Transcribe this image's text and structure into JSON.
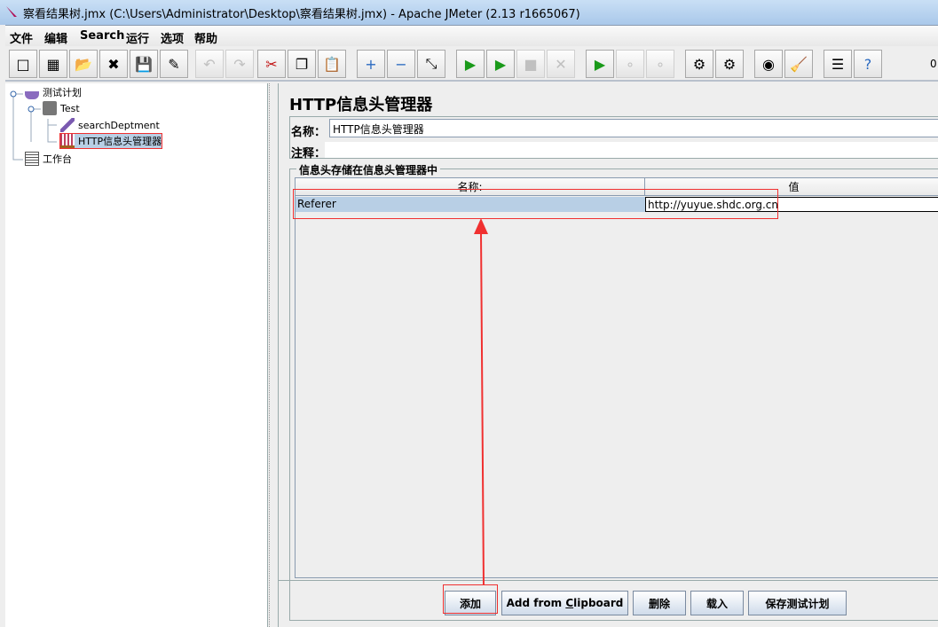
{
  "window": {
    "title": "察看结果树.jmx (C:\\Users\\Administrator\\Desktop\\察看结果树.jmx) - Apache JMeter (2.13 r1665067)",
    "icon": "jmeter-feather-icon"
  },
  "menu": [
    "文件",
    "编辑",
    "Search",
    "运行",
    "选项",
    "帮助"
  ],
  "toolbar": {
    "items": [
      "new",
      "templates",
      "open",
      "close",
      "save",
      "save-as",
      "undo",
      "redo",
      "cut",
      "copy",
      "paste",
      "expand",
      "collapse",
      "toggle",
      "start",
      "start-no-pauses",
      "stop",
      "shutdown",
      "remote-start-all",
      "remote-stop-all",
      "remote-shutdown-all",
      "clear",
      "clear-all",
      "search",
      "reset-search",
      "function-helper",
      "help"
    ],
    "counter": "0"
  },
  "tree": {
    "items": [
      {
        "label": "测试计划",
        "icon": "test-plan-flask-icon"
      },
      {
        "label": "Test",
        "icon": "thread-group-spool-icon"
      },
      {
        "label": "searchDeptment",
        "icon": "sampler-pipette-icon"
      },
      {
        "label": "HTTP信息头管理器",
        "icon": "config-test-tubes-icon",
        "selected": true
      },
      {
        "label": "工作台",
        "icon": "workbench-clipboard-icon"
      }
    ]
  },
  "panel": {
    "title": "HTTP信息头管理器",
    "name_label": "名称：",
    "name_value": "HTTP信息头管理器",
    "comment_label": "注释：",
    "comment_value": "",
    "group_title": "信息头存储在信息头管理器中",
    "columns": [
      "名称:",
      "值"
    ],
    "rows": [
      {
        "name": "Referer",
        "value": "http://yuyue.shdc.org.cn"
      }
    ],
    "buttons": {
      "add": "添加",
      "add_clipboard_pre": "Add from ",
      "add_clipboard_u": "C",
      "add_clipboard_post": "lipboard",
      "delete": "删除",
      "load": "载入",
      "save": "保存测试计划"
    }
  },
  "colors": {
    "selection": "#b8cfe5",
    "annotation": "#f03030"
  }
}
